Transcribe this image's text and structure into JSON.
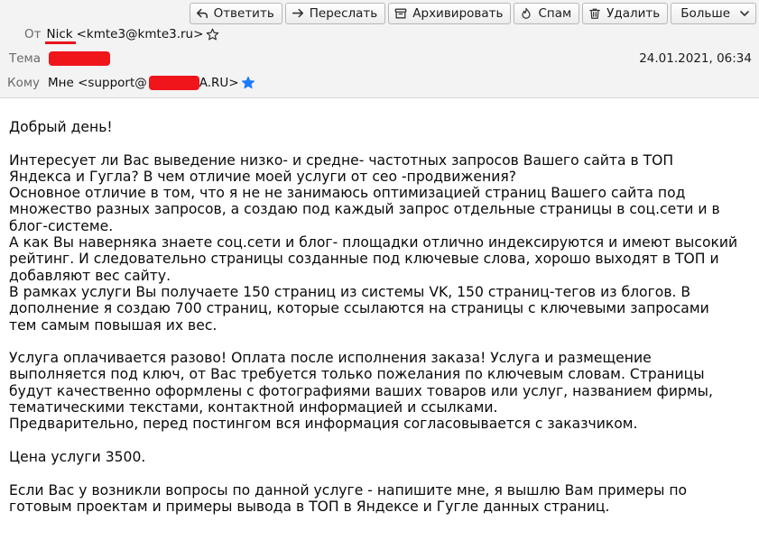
{
  "toolbar": {
    "reply": "Ответить",
    "forward": "Переслать",
    "archive": "Архивировать",
    "spam": "Спам",
    "delete": "Удалить",
    "more": "Больше"
  },
  "header": {
    "from_label": "От",
    "from_name": "Nick",
    "from_email": "<kmte3@kmte3.ru>",
    "subject_label": "Тема",
    "date": "24.01.2021, 06:34",
    "to_label": "Кому",
    "to_prefix": "Мне <support@",
    "to_suffix": "A.RU>"
  },
  "colors": {
    "redaction": "#f0141b",
    "header_bg": "#f3f3f3",
    "star_blue": "#1a7cff"
  },
  "body": {
    "text": "Добрый день!\n\nИнтересует ли Вас выведение низко- и средне- частотных запросов Вашего сайта в ТОП\nЯндекса и Гугла? В чем отличие моей услуги от сео -продвижения?\nОсновное отличие в том, что я не не занимаюсь оптимизацией страниц Вашего сайта под\nмножество разных запросов, а создаю под каждый запрос отдельные страницы в соц.сети и в\nблог-системе.\nА как Вы наверняка знаете соц.сети и блог- площадки отлично индексируются и имеют высокий\nрейтинг. И следовательно страницы созданные под ключевые слова, хорошо выходят в ТОП и\nдобавляют вес сайту.\nВ рамках услуги Вы получаете 150 страниц из системы VK, 150 страниц-тегов из блогов. В\nдополнение я создаю 700 страниц, которые ссылаются на страницы с ключевыми запросами\nтем самым повышая их вес.\n\nУслуга оплачивается разово! Оплата после исполнения заказа! Услуга и размещение\nвыполняется под ключ, от Вас требуется только пожелания по ключевым словам. Страницы\nбудут качественно оформлены с фотографиями ваших товаров или услуг, названием фирмы,\nтематическими текстами, контактной информацией и ссылками.\nПредварительно, перед постингом вся информация согласовывается с заказчиком.\n\nЦена услуги 3500.\n\nЕсли Вас у возникли вопросы по данной услуге - напишите мне, я вышлю Вам примеры по\nготовым проектам и примеры вывода в ТОП в Яндексе и Гугле данных страниц."
  }
}
